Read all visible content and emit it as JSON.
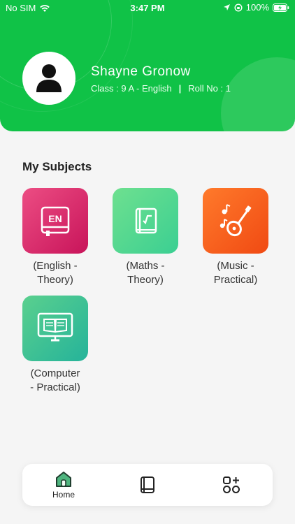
{
  "status_bar": {
    "carrier": "No SIM",
    "time": "3:47 PM",
    "battery": "100%"
  },
  "profile": {
    "name": "Shayne Gronow",
    "class_text": "Class : 9 A - English",
    "roll_text": "Roll No : 1"
  },
  "subjects": {
    "title": "My Subjects",
    "items": [
      {
        "line1": "(English -",
        "line2": "Theory)",
        "icon": "english-book-icon"
      },
      {
        "line1": "(Maths -",
        "line2": "Theory)",
        "icon": "maths-book-icon"
      },
      {
        "line1": "(Music -",
        "line2": "Practical)",
        "icon": "guitar-music-icon"
      },
      {
        "line1": "(Computer",
        "line2": "- Practical)",
        "icon": "computer-book-icon"
      }
    ],
    "english_badge": "EN"
  },
  "bottom_nav": {
    "home_label": "Home"
  },
  "colors": {
    "header_green": "#10c247",
    "home_icon": "#1f7a5a"
  }
}
